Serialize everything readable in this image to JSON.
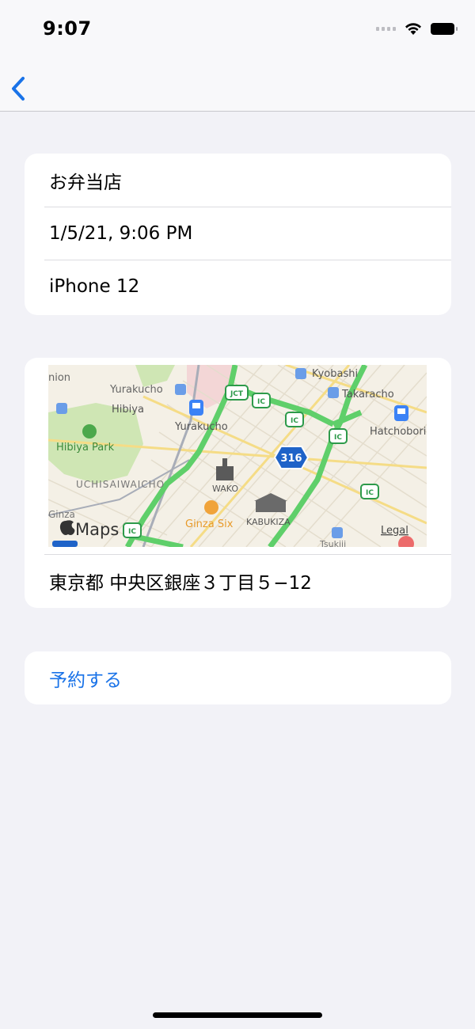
{
  "status_bar": {
    "time": "9:07"
  },
  "nav": {
    "back_icon": "chevron-left-icon"
  },
  "info": {
    "rows": [
      "お弁当店",
      "1/5/21, 9:06 PM",
      "iPhone 12"
    ]
  },
  "map": {
    "address": "東京都 中央区銀座３丁目５−12",
    "attribution": "Maps",
    "legal": "Legal",
    "labels": {
      "nion": "nion",
      "yurakucho_top": "Yurakucho",
      "kyobashi": "Kyobashi",
      "takaracho": "Takaracho",
      "hibiya": "Hibiya",
      "yurakucho": "Yurakucho",
      "hatchobori": "Hatchobori",
      "hibiya_park": "Hibiya Park",
      "uchisaiwaicho": "UCHISAIWAICHO",
      "wako": "WAKO",
      "ginza_six": "Ginza Six",
      "kabukiza": "KABUKIZA",
      "ginza": "Ginza",
      "tsukiji": "Tsukiji",
      "route": "316",
      "jct": "JCT",
      "ic": "IC"
    }
  },
  "action": {
    "reserve_label": "予約する"
  },
  "colors": {
    "accent": "#1a73e8",
    "background": "#f2f2f7",
    "card": "#ffffff",
    "expressway": "#5fcf6a"
  }
}
